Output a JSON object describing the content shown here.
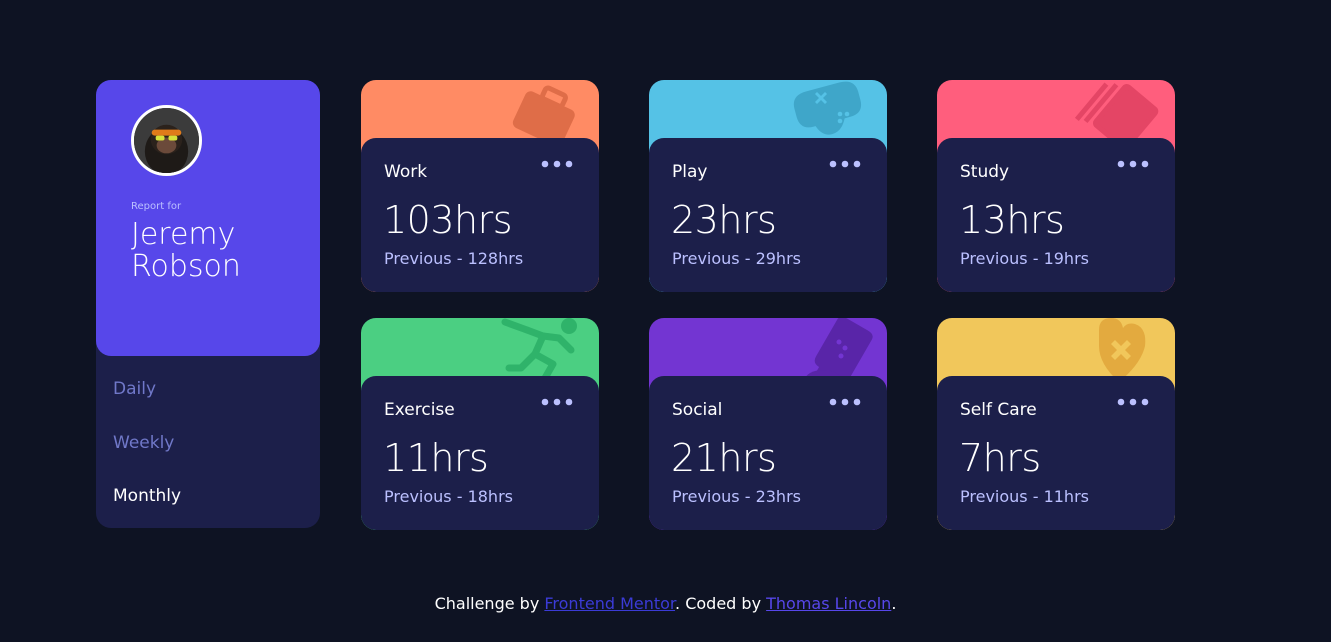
{
  "profile": {
    "report_label": "Report for",
    "first_name": "Jeremy",
    "last_name": "Robson"
  },
  "periods": [
    {
      "label": "Daily",
      "active": false
    },
    {
      "label": "Weekly",
      "active": false
    },
    {
      "label": "Monthly",
      "active": true
    }
  ],
  "cards": [
    {
      "title": "Work",
      "hours": "103hrs",
      "previous": "Previous - 128hrs",
      "color": "#ff8b64",
      "icon": "briefcase-icon"
    },
    {
      "title": "Play",
      "hours": "23hrs",
      "previous": "Previous - 29hrs",
      "color": "#55c2e6",
      "icon": "gamepad-icon"
    },
    {
      "title": "Study",
      "hours": "13hrs",
      "previous": "Previous - 19hrs",
      "color": "#ff5e7d",
      "icon": "book-icon"
    },
    {
      "title": "Exercise",
      "hours": "11hrs",
      "previous": "Previous - 18hrs",
      "color": "#4bcf82",
      "icon": "running-icon"
    },
    {
      "title": "Social",
      "hours": "21hrs",
      "previous": "Previous - 23hrs",
      "color": "#7335d2",
      "icon": "social-icon"
    },
    {
      "title": "Self Care",
      "hours": "7hrs",
      "previous": "Previous - 11hrs",
      "color": "#f1c75b",
      "icon": "heart-icon"
    }
  ],
  "footer": {
    "prefix": "Challenge by ",
    "challenge_link": "Frontend Mentor",
    "middle": ". Coded by ",
    "author_link": "Thomas Lincoln",
    "suffix": "."
  }
}
